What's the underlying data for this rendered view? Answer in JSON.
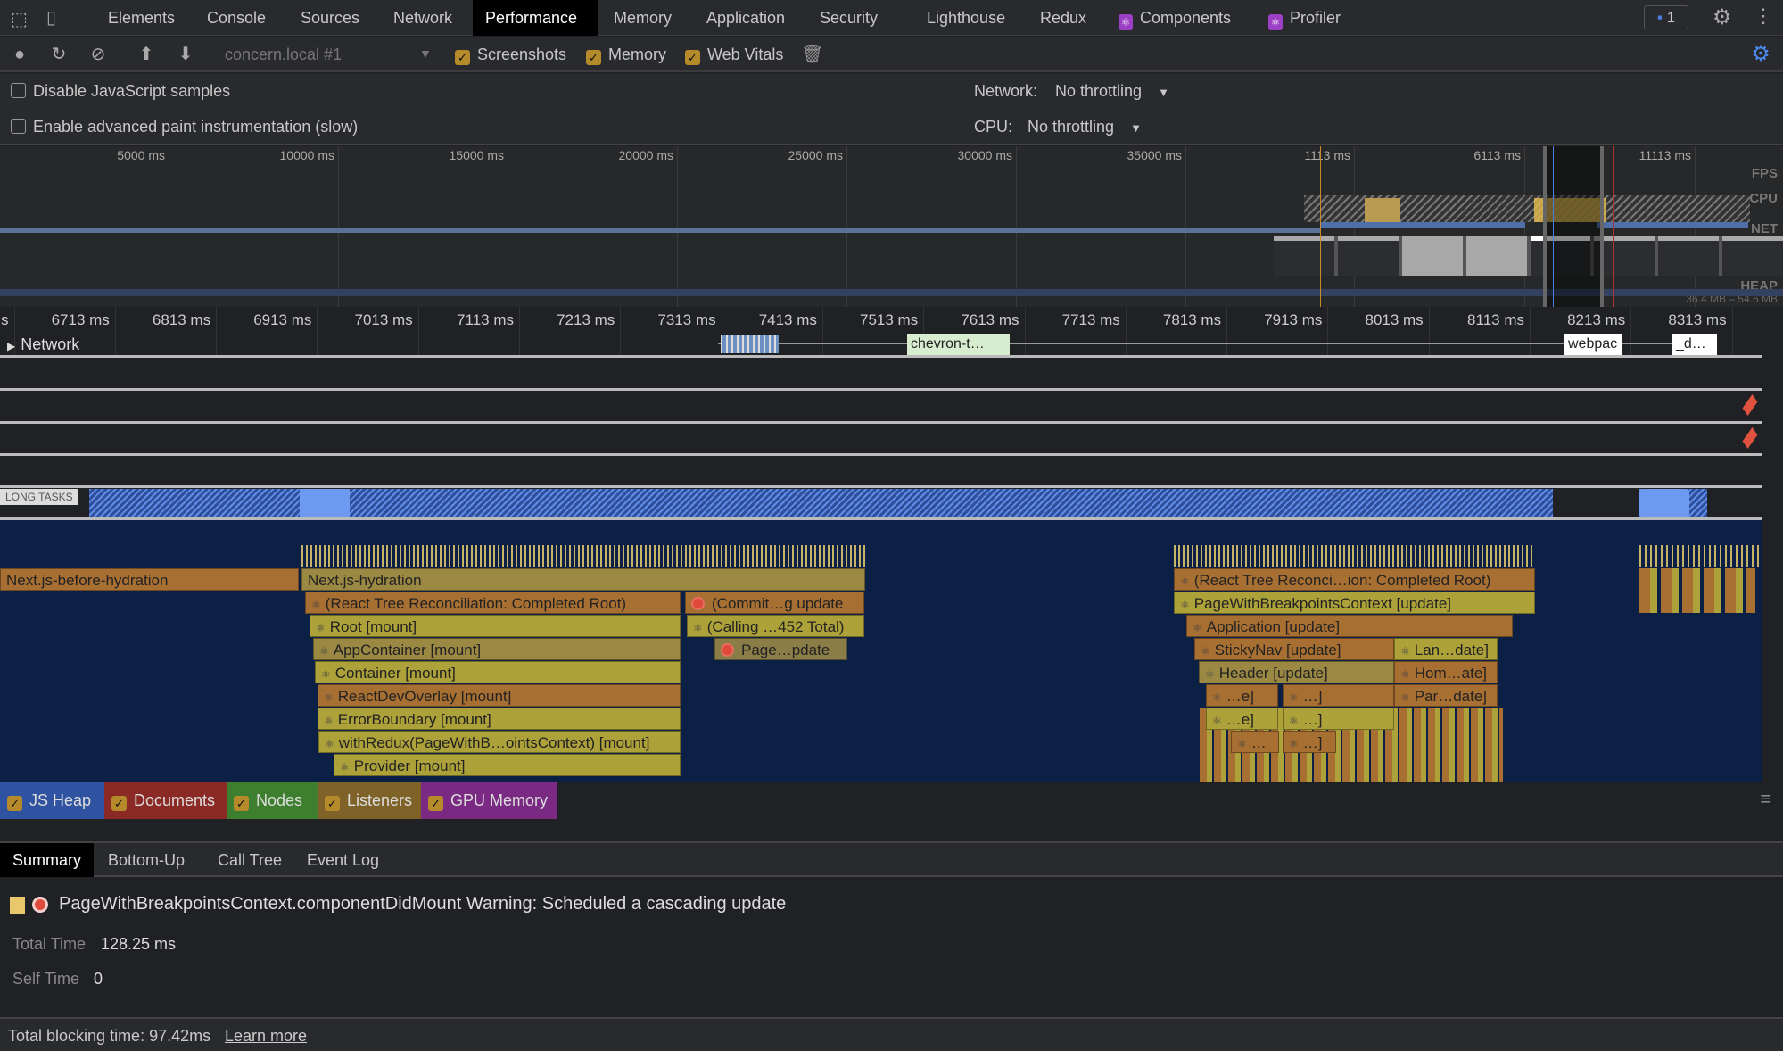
{
  "tabs": [
    "Elements",
    "Console",
    "Sources",
    "Network",
    "Performance",
    "Memory",
    "Application",
    "Security",
    "Lighthouse",
    "Redux",
    "Components",
    "Profiler"
  ],
  "active_tab": "Performance",
  "issues_badge": "1",
  "toolbar": {
    "profile_select": "concern.local #1",
    "screenshots": "Screenshots",
    "memory": "Memory",
    "web_vitals": "Web Vitals",
    "icons": [
      "record-icon",
      "reload-icon",
      "clear-icon",
      "upload-icon",
      "download-icon",
      "trash-icon",
      "capture-settings-icon"
    ]
  },
  "settings": {
    "disable_js": "Disable JavaScript samples",
    "advanced_paint": "Enable advanced paint instrumentation (slow)",
    "network_label": "Network:",
    "network_value": "No throttling",
    "cpu_label": "CPU:",
    "cpu_value": "No throttling"
  },
  "overview": {
    "ticks": [
      "5000 ms",
      "10000 ms",
      "15000 ms",
      "20000 ms",
      "25000 ms",
      "30000 ms",
      "35000 ms",
      "1113 ms",
      "6113 ms",
      "11113 ms"
    ],
    "tracks": [
      "FPS",
      "CPU",
      "NET",
      "HEAP"
    ],
    "heap_range": "36.4 MB – 54.6 MB"
  },
  "ruler": [
    "s",
    "6713 ms",
    "6813 ms",
    "6913 ms",
    "7013 ms",
    "7113 ms",
    "7213 ms",
    "7313 ms",
    "7413 ms",
    "7513 ms",
    "7613 ms",
    "7713 ms",
    "7813 ms",
    "7913 ms",
    "8013 ms",
    "8113 ms",
    "8213 ms",
    "8313 ms"
  ],
  "network": {
    "label": "Network",
    "requests": [
      "chevron-t…",
      "webpac",
      "_d…"
    ]
  },
  "long_tasks": "LONG TASKS",
  "flame": {
    "left": [
      "Next.js-before-hydration",
      "Next.js-hydration",
      "(React Tree Reconciliation: Completed Root)",
      "(Commit…g update",
      "Root [mount]",
      "(Calling …452 Total)",
      "AppContainer [mount]",
      "Page…pdate",
      "Container [mount]",
      "ReactDevOverlay [mount]",
      "ErrorBoundary [mount]",
      "withRedux(PageWithB…ointsContext) [mount]",
      "Provider [mount]"
    ],
    "right": [
      "(React Tree Reconci…ion: Completed Root)",
      "PageWithBreakpointsContext [update]",
      "Application [update]",
      "StickyNav [update]",
      "Lan…date]",
      "Header [update]",
      "Hom…ate]",
      "…e]",
      "…]",
      "Par…date]",
      "…e]",
      "…]",
      "…",
      "…]"
    ]
  },
  "counters": [
    {
      "label": "JS Heap",
      "color": "#2f53a0"
    },
    {
      "label": "Documents",
      "color": "#8b2a24"
    },
    {
      "label": "Nodes",
      "color": "#3d7f2e"
    },
    {
      "label": "Listeners",
      "color": "#7f6227"
    },
    {
      "label": "GPU Memory",
      "color": "#7a2a82"
    }
  ],
  "bottom_tabs": [
    "Summary",
    "Bottom-Up",
    "Call Tree",
    "Event Log"
  ],
  "summary": {
    "title": "PageWithBreakpointsContext.componentDidMount Warning: Scheduled a cascading update",
    "total_time_label": "Total Time",
    "total_time": "128.25 ms",
    "self_time_label": "Self Time",
    "self_time": "0"
  },
  "footer": {
    "text": "Total blocking time: 97.42ms",
    "link": "Learn more"
  }
}
